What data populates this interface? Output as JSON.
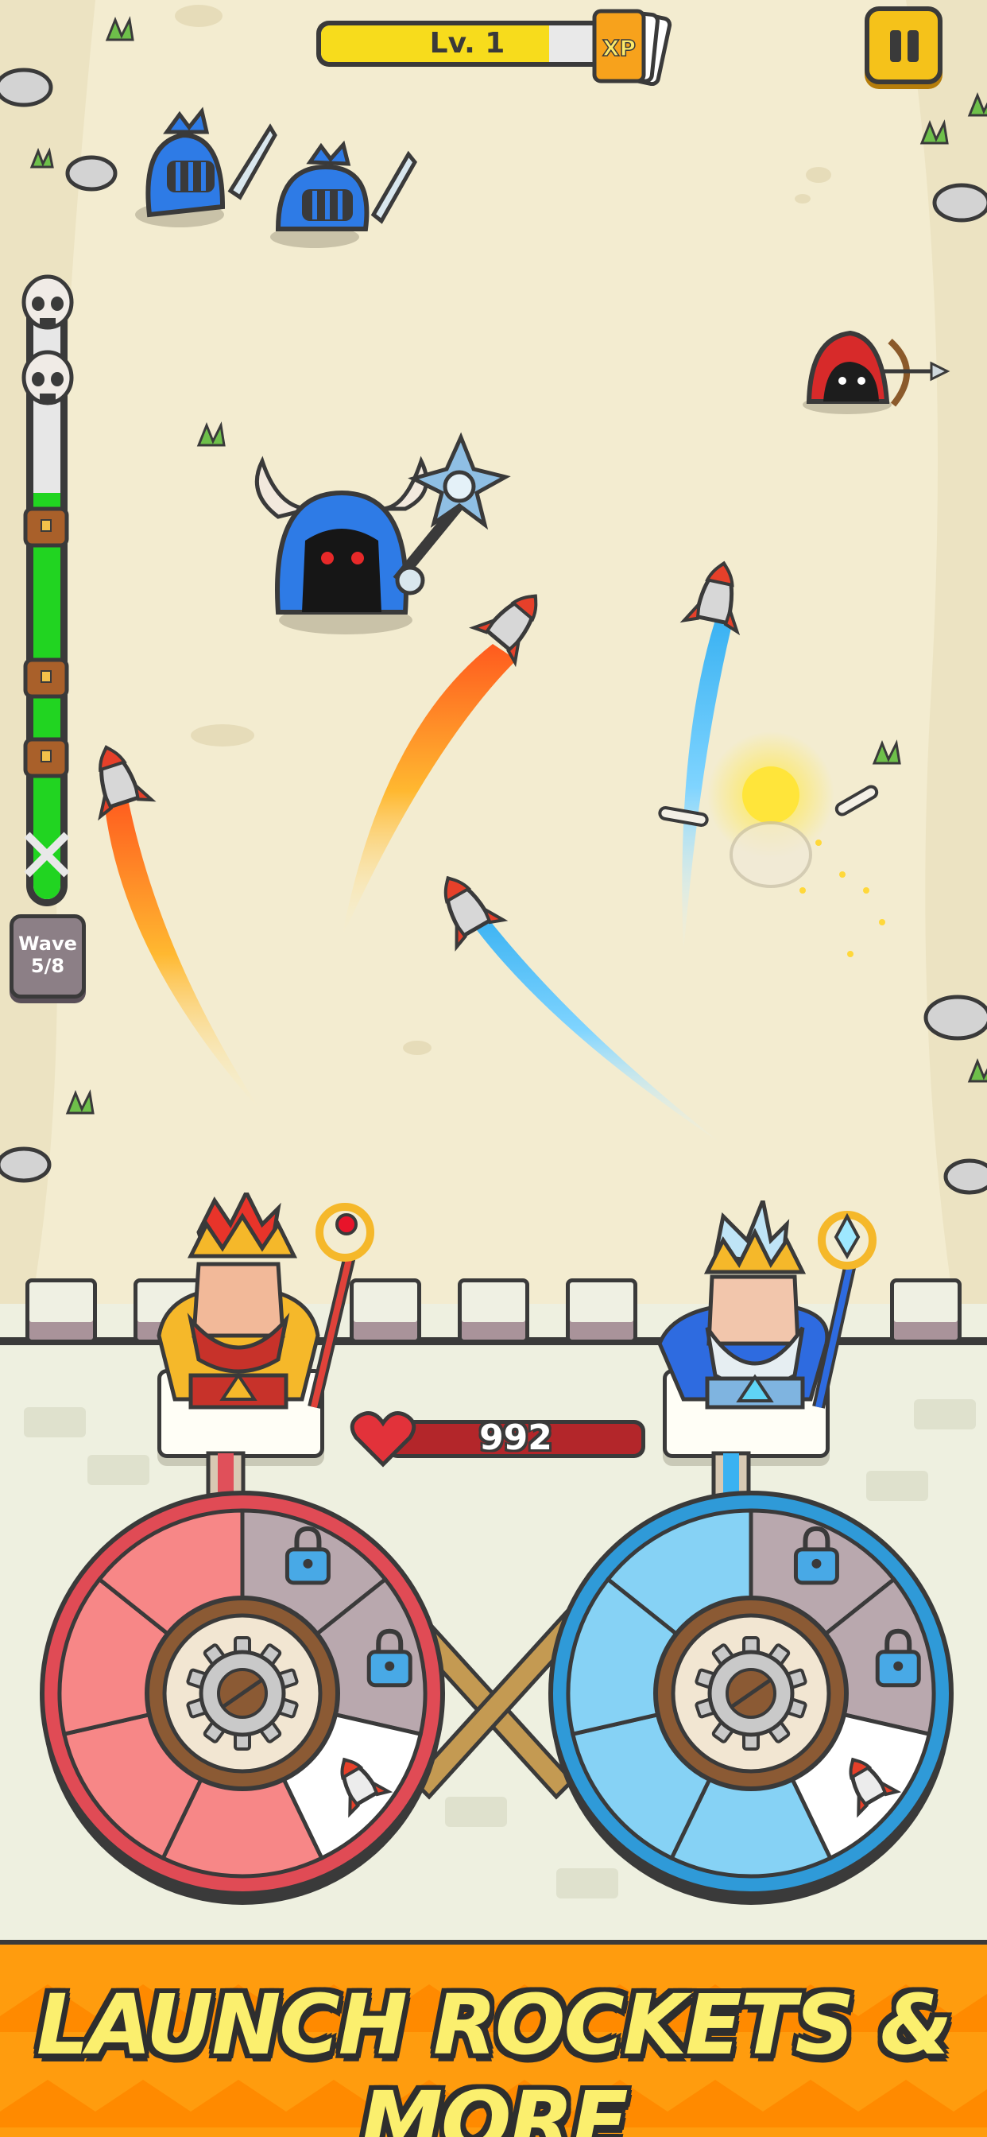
{
  "hud": {
    "level_label": "Lv. 1",
    "xp_progress": 0.78,
    "xp_label": "XP",
    "pause_icon": "pause-icon"
  },
  "wave": {
    "label": "Wave",
    "count": "5/8",
    "progress": 0.68,
    "markers": [
      "skull-icon",
      "skull-icon",
      "chest-icon",
      "chest-icon",
      "chest-icon"
    ]
  },
  "castle": {
    "health": "992",
    "health_progress": 1.0
  },
  "heroes": [
    {
      "name": "fire-king",
      "wheel_color": "#e04b55",
      "wheel_light": "#f78787",
      "slots": [
        "lock-icon",
        "lock-icon",
        "rocket-icon"
      ]
    },
    {
      "name": "ice-king",
      "wheel_color": "#2f9ad8",
      "wheel_light": "#86d2f5",
      "slots": [
        "lock-icon",
        "lock-icon",
        "rocket-icon"
      ]
    }
  ],
  "enemies": [
    "blue-knight",
    "blue-knight",
    "horned-knight-boss",
    "red-hood-archer"
  ],
  "banner": {
    "text": "LAUNCH ROCKETS & MORE"
  },
  "colors": {
    "ground": "#f3ecd0",
    "banner": "#ff9c0e",
    "banner_text": "#fbef6e",
    "wave_fill": "#21d421",
    "xp_fill": "#f7dc1c",
    "health_fill": "#b3262a"
  }
}
